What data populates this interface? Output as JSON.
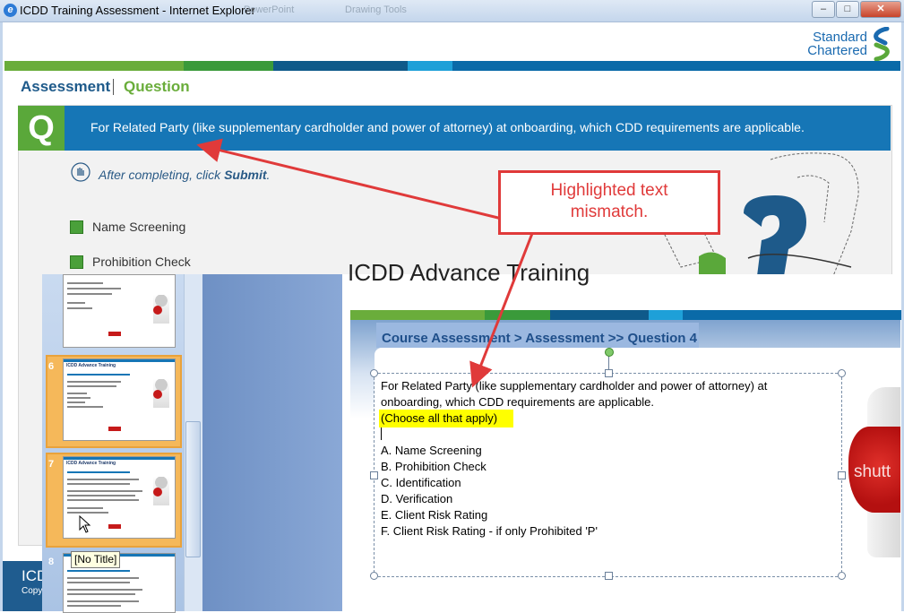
{
  "window": {
    "title": "ICDD Training Assessment - Internet Explorer",
    "ghost_text_1": "PowerPoint",
    "ghost_text_2": "Drawing Tools",
    "buttons": {
      "minimize": "–",
      "maximize": "□",
      "close": "✕"
    }
  },
  "logo": {
    "line1": "Standard",
    "line2": "Chartered"
  },
  "breadcrumb": {
    "section": "Assessment",
    "page": "Question"
  },
  "question": {
    "badge": "Q",
    "text": "For Related Party (like supplementary cardholder and power of attorney) at onboarding, which CDD requirements are applicable.",
    "instruction_prefix": "After completing, click ",
    "instruction_action": "Submit",
    "instruction_suffix": ".",
    "options": [
      "Name Screening",
      "Prohibition Check"
    ]
  },
  "callout": {
    "line1": "Highlighted text",
    "line2": "mismatch."
  },
  "footer": {
    "title": "ICD",
    "sub": "Copy"
  },
  "ppt": {
    "slide_title": "ICDD Advance Training",
    "thumbnails": [
      {
        "num": "",
        "caption": ""
      },
      {
        "num": "6",
        "caption": "ICDD Advance Training"
      },
      {
        "num": "7",
        "caption": "ICDD Advance Training"
      },
      {
        "num": "8",
        "caption": ""
      }
    ],
    "tooltip": "[No Title]",
    "slide": {
      "header": "Course Assessment > Assessment >> Question 4",
      "line1": "For Related Party (like supplementary cardholder and power of attorney) at",
      "line2": "onboarding, which CDD requirements are applicable.",
      "highlight": "(Choose all that apply)",
      "options": [
        "A.  Name Screening",
        "B.  Prohibition Check",
        "C.  Identification",
        "D.  Verification",
        "E. Client Risk Rating",
        "F. Client Risk Rating - if only Prohibited 'P'"
      ],
      "image_watermark": "shutt"
    }
  },
  "colors": {
    "band": [
      "#6aad3b",
      "#3a9a3a",
      "#0f5a8a",
      "#1ea0d8",
      "#0a6aa8"
    ],
    "question_bar": "#1676b6",
    "badge": "#5aa83a",
    "callout": "#e03a3a"
  }
}
